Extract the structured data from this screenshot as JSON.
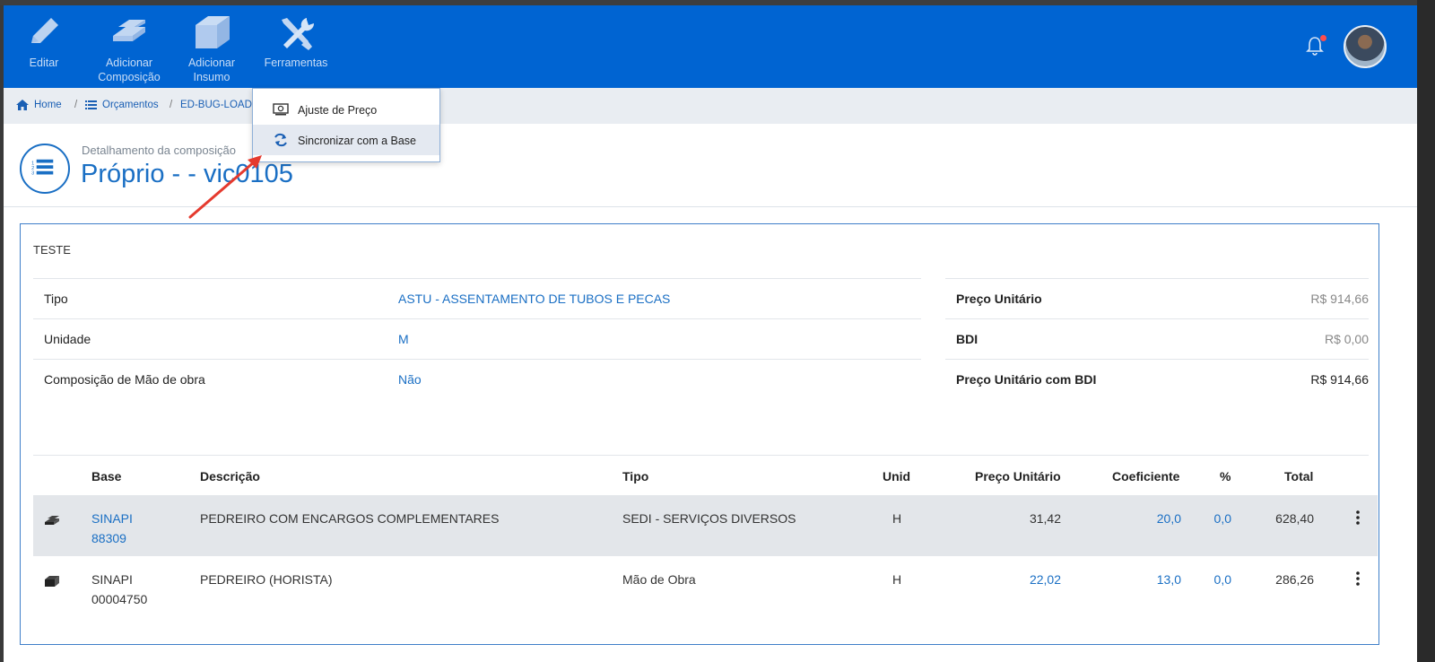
{
  "toolbar": {
    "items": [
      {
        "label": "Editar",
        "icon": "pencil-icon"
      },
      {
        "label": "Adicionar\nComposição",
        "icon": "bricks-icon"
      },
      {
        "label": "Adicionar\nInsumo",
        "icon": "block-icon"
      },
      {
        "label": "Ferramentas",
        "icon": "tools-icon"
      }
    ]
  },
  "breadcrumb": {
    "home": "Home",
    "orcamentos": "Orçamentos",
    "current": "ED-BUG-LOADIN"
  },
  "dropdown": {
    "items": [
      {
        "label": "Ajuste de Preço",
        "icon": "money-icon"
      },
      {
        "label": "Sincronizar com a Base",
        "icon": "sync-icon"
      }
    ]
  },
  "page": {
    "subtitle": "Detalhamento da composição",
    "title": "Próprio - - vic0105"
  },
  "card": {
    "title": "TESTE",
    "info": [
      {
        "key": "Tipo",
        "value": "ASTU - ASSENTAMENTO DE TUBOS E PECAS"
      },
      {
        "key": "Unidade",
        "value": "M"
      },
      {
        "key": "Composição de Mão de obra",
        "value": "Não"
      }
    ],
    "prices": [
      {
        "key": "Preço Unitário",
        "value": "R$ 914,66"
      },
      {
        "key": "BDI",
        "value": "R$ 0,00"
      },
      {
        "key": "Preço Unitário com BDI",
        "value": "R$ 914,66"
      }
    ]
  },
  "table": {
    "headers": {
      "base": "Base",
      "descricao": "Descrição",
      "tipo": "Tipo",
      "unid": "Unid",
      "preco": "Preço Unitário",
      "coef": "Coeficiente",
      "pct": "%",
      "total": "Total"
    },
    "rows": [
      {
        "base1": "SINAPI",
        "base2": "88309",
        "descricao": "PEDREIRO COM ENCARGOS COMPLEMENTARES",
        "tipo": "SEDI - SERVIÇOS DIVERSOS",
        "unid": "H",
        "preco": "31,42",
        "coef": "20,0",
        "pct": "0,0",
        "total": "628,40",
        "icon": "bricks-icon"
      },
      {
        "base1": "SINAPI",
        "base2": "00004750",
        "descricao": "PEDREIRO (HORISTA)",
        "tipo": "Mão de Obra",
        "unid": "H",
        "preco": "22,02",
        "coef": "13,0",
        "pct": "0,0",
        "total": "286,26",
        "icon": "block-icon"
      }
    ]
  },
  "colors": {
    "header": "#0064d2",
    "accent": "#1a6fc4",
    "notification": "#ff4d4d"
  }
}
